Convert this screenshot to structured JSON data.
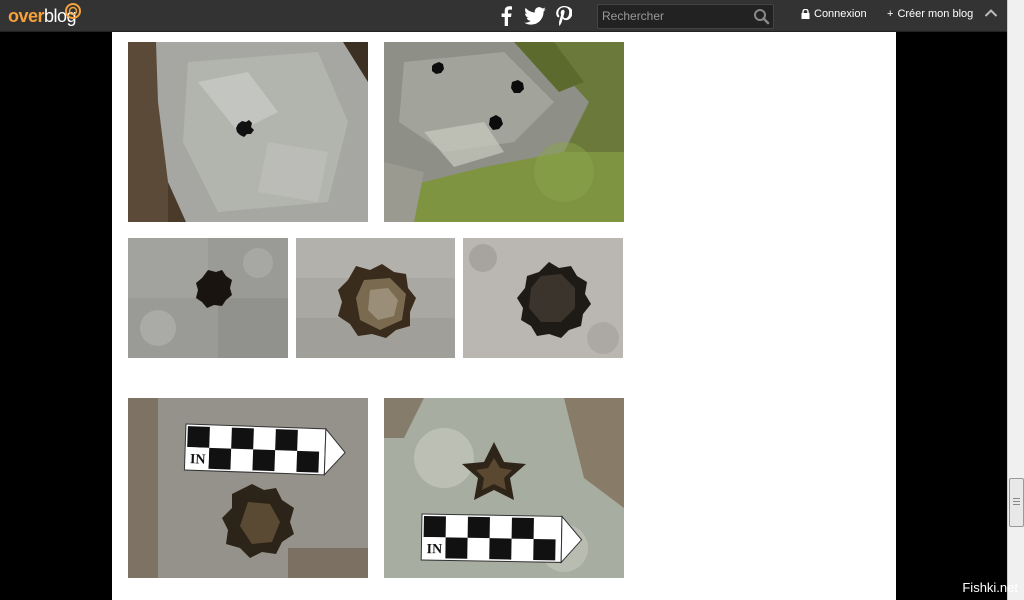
{
  "header": {
    "logo_text_orange": "over",
    "logo_text_white": "blog",
    "search_placeholder": "Rechercher",
    "login_label": "Connexion",
    "create_label": "Créer mon blog",
    "create_prefix": "+"
  },
  "social": [
    "facebook-icon",
    "twitter-icon",
    "pinterest-icon"
  ],
  "photos": [
    {
      "name": "photo-rock-single-hole",
      "desc": "rock with small star-shaped hole"
    },
    {
      "name": "photo-rock-three-holes",
      "desc": "moss-covered rock with three holes"
    },
    {
      "name": "photo-star-hole-1"
    },
    {
      "name": "photo-star-hole-2"
    },
    {
      "name": "photo-star-hole-3"
    },
    {
      "name": "photo-star-hole-scale-1",
      "scale_label": "IN"
    },
    {
      "name": "photo-star-hole-scale-2",
      "scale_label": "IN"
    }
  ],
  "watermark": "Fishki.net",
  "colors": {
    "topbar": "#333333",
    "logo_orange": "#f6a23a",
    "page_bg": "#ffffff",
    "outside_bg": "#000000"
  }
}
